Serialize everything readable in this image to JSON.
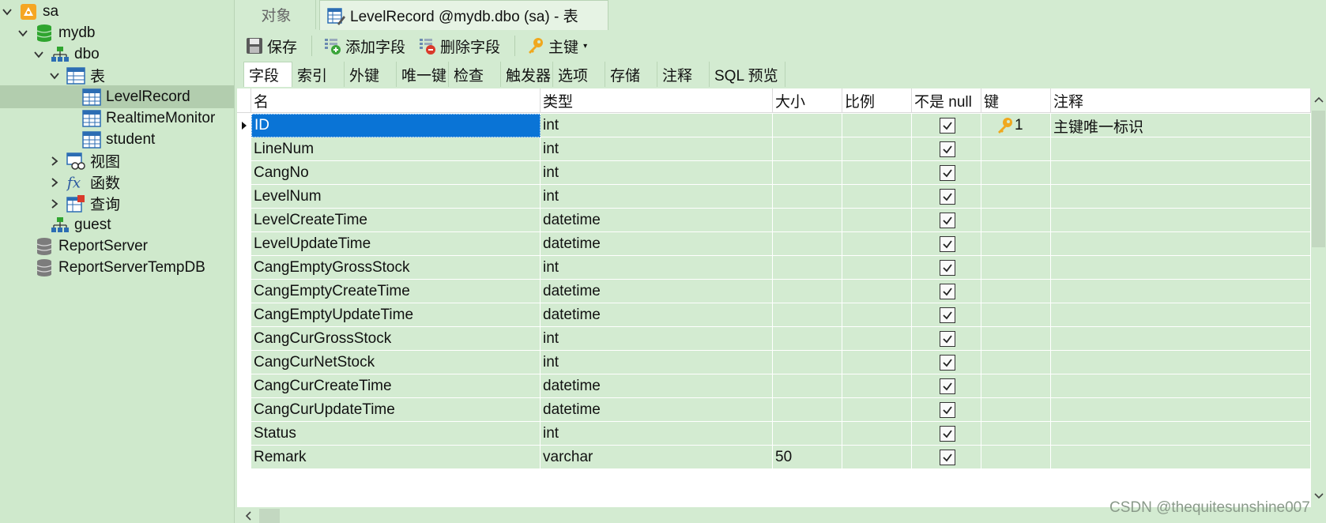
{
  "sidebar": {
    "nodes": [
      {
        "label": "sa",
        "level": 0,
        "expand": "expanded",
        "icon": "server-icon"
      },
      {
        "label": "mydb",
        "level": 1,
        "expand": "expanded",
        "icon": "database-icon"
      },
      {
        "label": "dbo",
        "level": 2,
        "expand": "expanded",
        "icon": "schema-icon"
      },
      {
        "label": "表",
        "level": 3,
        "expand": "expanded",
        "icon": "tables-folder-icon"
      },
      {
        "label": "LevelRecord",
        "level": 4,
        "expand": "none",
        "icon": "table-icon",
        "selected": true
      },
      {
        "label": "RealtimeMonitor",
        "level": 4,
        "expand": "none",
        "icon": "table-icon"
      },
      {
        "label": "student",
        "level": 4,
        "expand": "none",
        "icon": "table-icon"
      },
      {
        "label": "视图",
        "level": 3,
        "expand": "collapsed",
        "icon": "view-icon"
      },
      {
        "label": "函数",
        "level": 3,
        "expand": "collapsed",
        "icon": "function-icon"
      },
      {
        "label": "查询",
        "level": 3,
        "expand": "collapsed",
        "icon": "query-icon"
      },
      {
        "label": "guest",
        "level": 2,
        "expand": "none",
        "icon": "schema-icon"
      },
      {
        "label": "ReportServer",
        "level": 1,
        "expand": "none",
        "icon": "database-gray-icon"
      },
      {
        "label": "ReportServerTempDB",
        "level": 1,
        "expand": "none",
        "icon": "database-gray-icon"
      }
    ]
  },
  "tabs": {
    "objects": "对象",
    "active": "LevelRecord @mydb.dbo (sa) - 表"
  },
  "toolbar": {
    "save": "保存",
    "add_field": "添加字段",
    "delete_field": "删除字段",
    "primary_key": "主键"
  },
  "subtabs": [
    "字段",
    "索引",
    "外键",
    "唯一键",
    "检查",
    "触发器",
    "选项",
    "存储",
    "注释",
    "SQL 预览"
  ],
  "grid": {
    "headers": [
      "名",
      "类型",
      "大小",
      "比例",
      "不是 null",
      "键",
      "注释"
    ],
    "rows": [
      {
        "name": "ID",
        "type": "int",
        "size": "",
        "scale": "",
        "not_null": true,
        "key": "1",
        "comment": "主键唯一标识"
      },
      {
        "name": "LineNum",
        "type": "int",
        "size": "",
        "scale": "",
        "not_null": true,
        "key": "",
        "comment": ""
      },
      {
        "name": "CangNo",
        "type": "int",
        "size": "",
        "scale": "",
        "not_null": true,
        "key": "",
        "comment": ""
      },
      {
        "name": "LevelNum",
        "type": "int",
        "size": "",
        "scale": "",
        "not_null": true,
        "key": "",
        "comment": ""
      },
      {
        "name": "LevelCreateTime",
        "type": "datetime",
        "size": "",
        "scale": "",
        "not_null": true,
        "key": "",
        "comment": ""
      },
      {
        "name": "LevelUpdateTime",
        "type": "datetime",
        "size": "",
        "scale": "",
        "not_null": true,
        "key": "",
        "comment": ""
      },
      {
        "name": "CangEmptyGrossStock",
        "type": "int",
        "size": "",
        "scale": "",
        "not_null": true,
        "key": "",
        "comment": ""
      },
      {
        "name": "CangEmptyCreateTime",
        "type": "datetime",
        "size": "",
        "scale": "",
        "not_null": true,
        "key": "",
        "comment": ""
      },
      {
        "name": "CangEmptyUpdateTime",
        "type": "datetime",
        "size": "",
        "scale": "",
        "not_null": true,
        "key": "",
        "comment": ""
      },
      {
        "name": "CangCurGrossStock",
        "type": "int",
        "size": "",
        "scale": "",
        "not_null": true,
        "key": "",
        "comment": ""
      },
      {
        "name": "CangCurNetStock",
        "type": "int",
        "size": "",
        "scale": "",
        "not_null": true,
        "key": "",
        "comment": ""
      },
      {
        "name": "CangCurCreateTime",
        "type": "datetime",
        "size": "",
        "scale": "",
        "not_null": true,
        "key": "",
        "comment": ""
      },
      {
        "name": "CangCurUpdateTime",
        "type": "datetime",
        "size": "",
        "scale": "",
        "not_null": true,
        "key": "",
        "comment": ""
      },
      {
        "name": "Status",
        "type": "int",
        "size": "",
        "scale": "",
        "not_null": true,
        "key": "",
        "comment": ""
      },
      {
        "name": "Remark",
        "type": "varchar",
        "size": "50",
        "scale": "",
        "not_null": true,
        "key": "",
        "comment": ""
      }
    ]
  },
  "watermark": "CSDN @thequitesunshine007",
  "colors": {
    "background": "#d3ebd1",
    "selection": "#0a74d6",
    "key_gold": "#f0a81e"
  }
}
